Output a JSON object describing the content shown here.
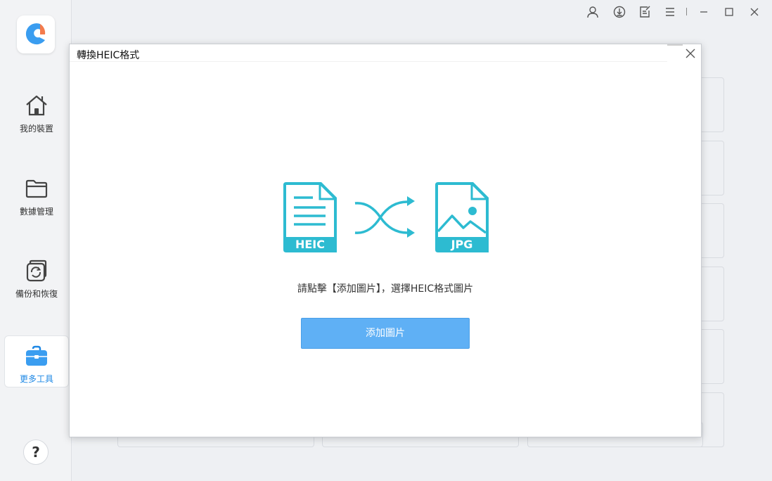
{
  "sidebar": {
    "items": [
      {
        "label": "我的裝置",
        "icon": "home-icon"
      },
      {
        "label": "數據管理",
        "icon": "folder-icon"
      },
      {
        "label": "備份和恢復",
        "icon": "backup-restore-icon"
      },
      {
        "label": "更多工具",
        "icon": "toolbox-icon",
        "active": true
      }
    ],
    "help_label": "?"
  },
  "window_controls": [
    "account-icon",
    "download-icon",
    "feedback-icon",
    "menu-icon",
    "minimize-icon",
    "maximize-icon",
    "close-icon"
  ],
  "dialog": {
    "title": "轉換HEIC格式",
    "heic_label": "HEIC",
    "jpg_label": "JPG",
    "hint": "請點擊【添加圖片】，選擇HEIC格式圖片",
    "add_button": "添加圖片"
  },
  "colors": {
    "accent_teal": "#2dbbd1",
    "button_blue": "#5fb0f5",
    "active_nav": "#1e88e5"
  }
}
